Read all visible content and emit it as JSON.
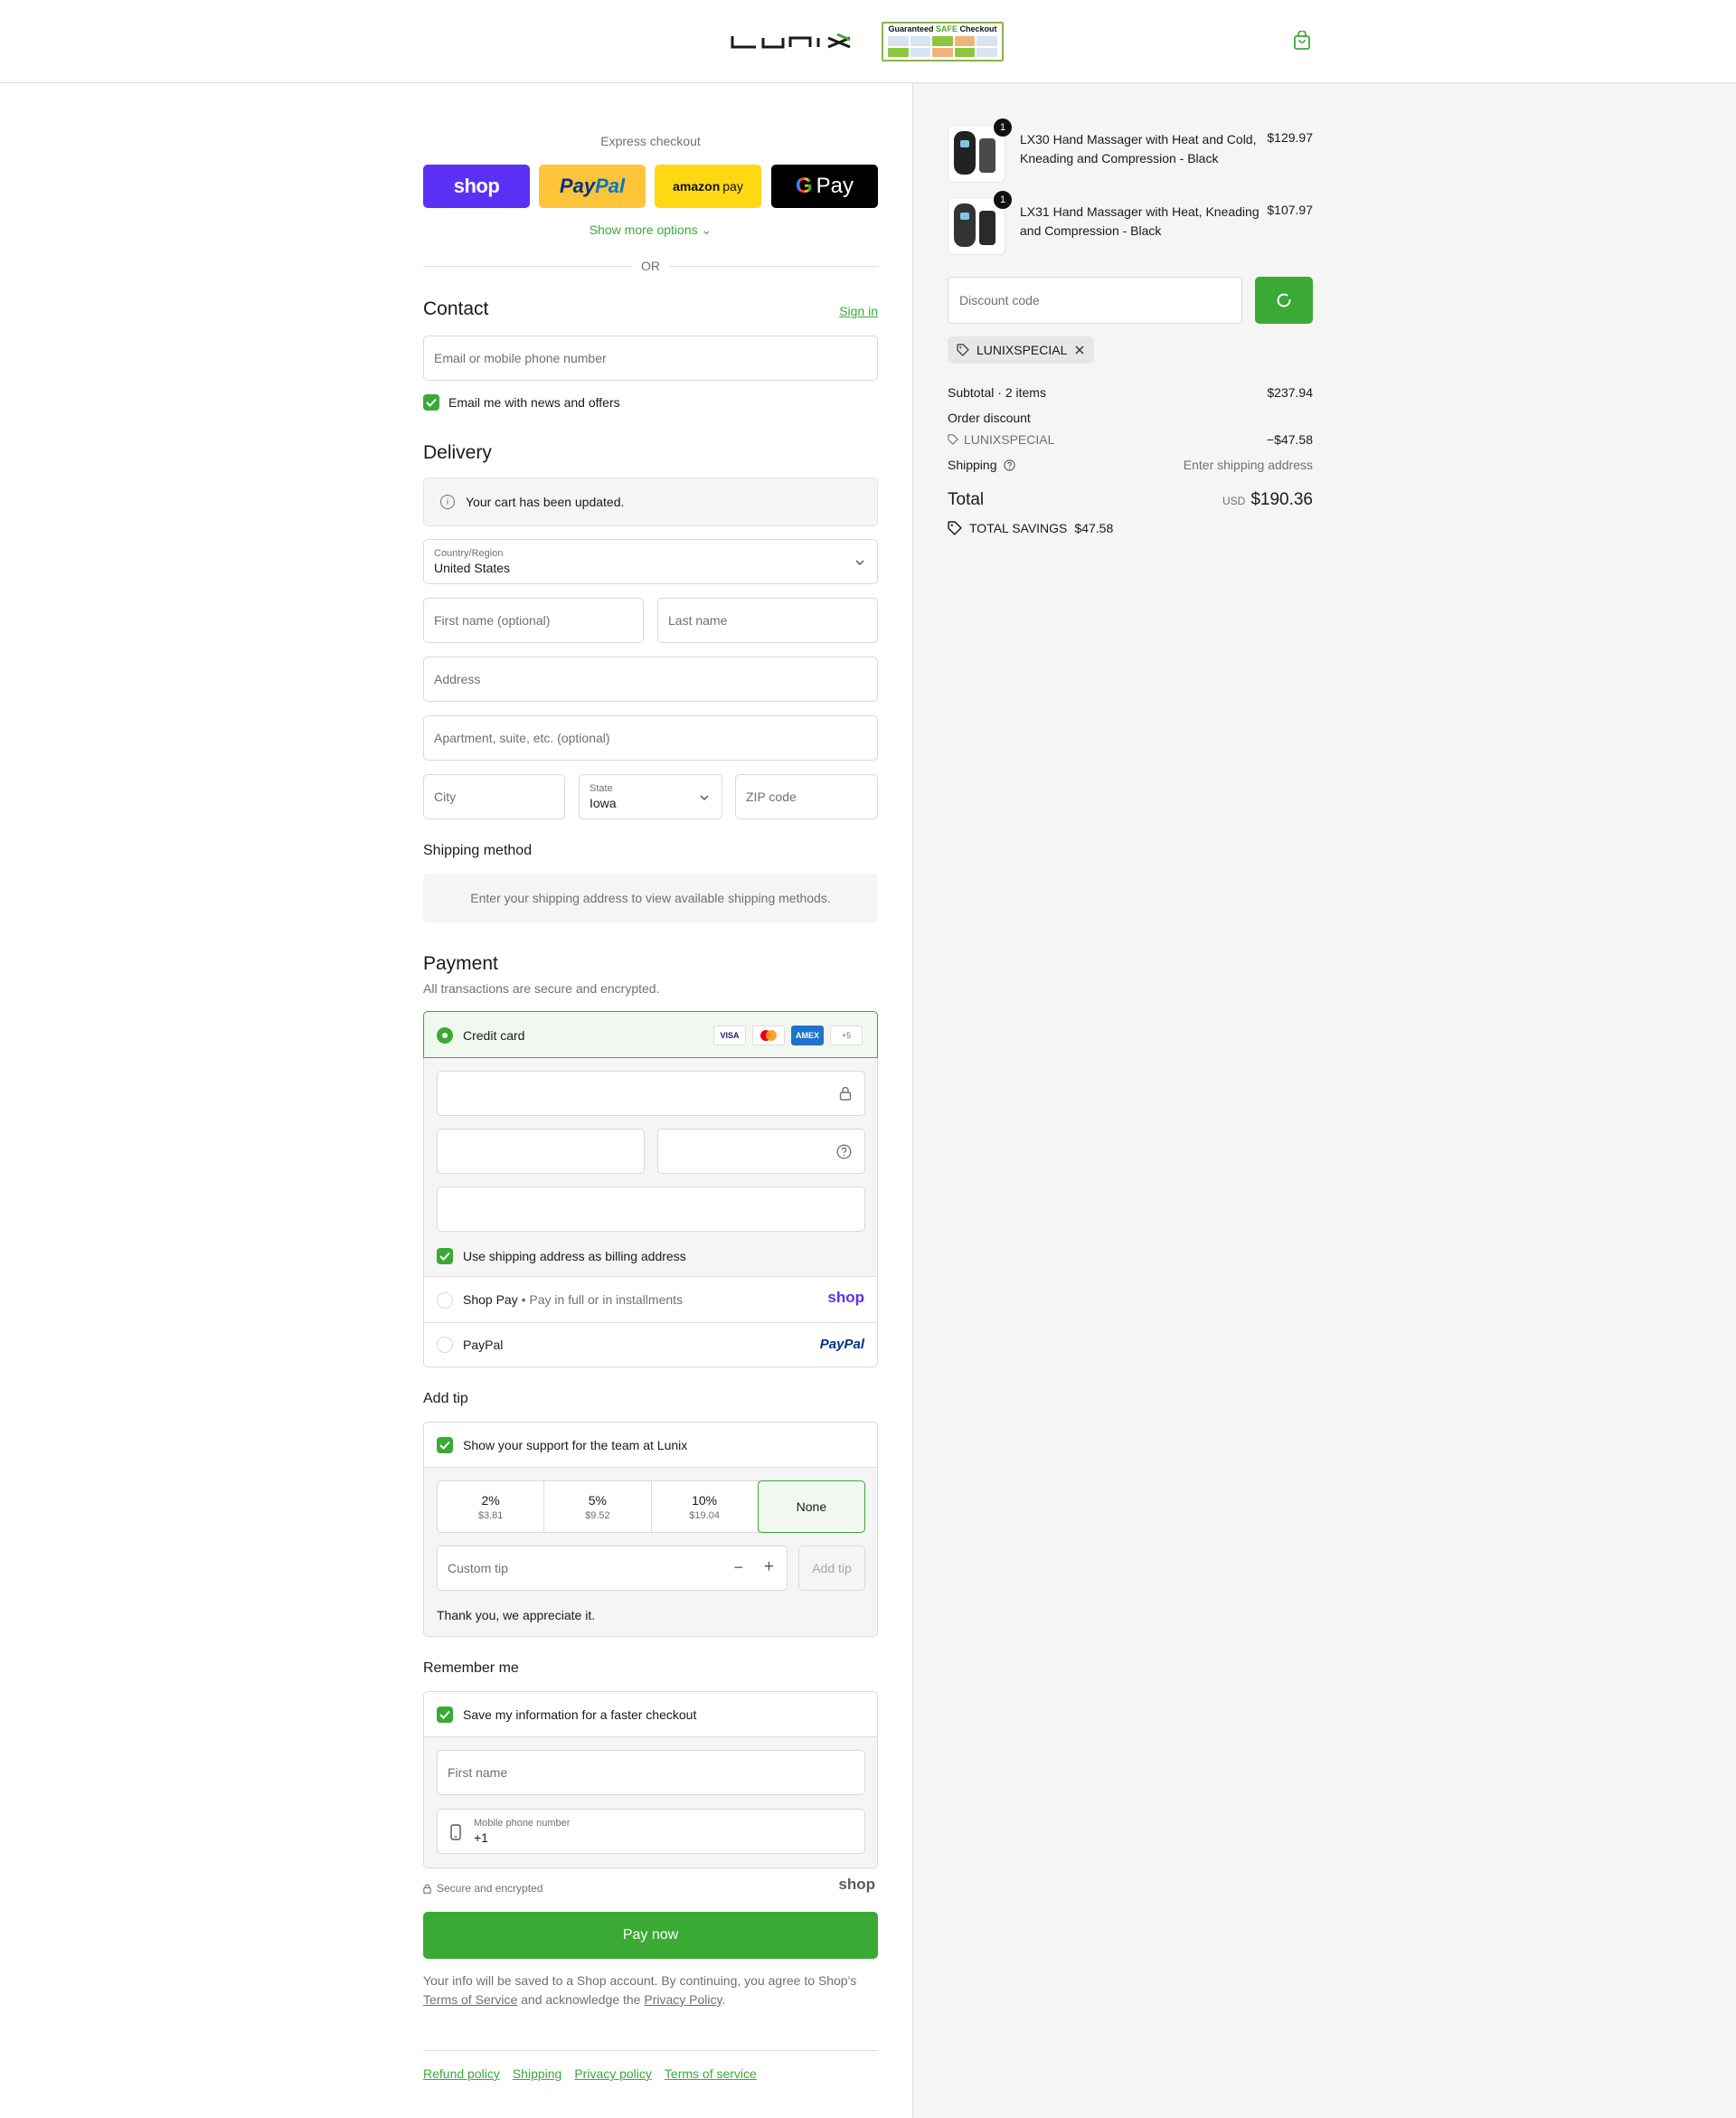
{
  "header": {
    "brand": "Lunix",
    "badge_title_prefix": "Guaranteed",
    "badge_title_safe": "SAFE",
    "badge_title_suffix": "Checkout"
  },
  "express": {
    "title": "Express checkout",
    "shop_label": "shop",
    "paypal_label_1": "Pay",
    "paypal_label_2": "Pal",
    "amazon_label": "amazon",
    "amazon_pay": "pay",
    "gpay_g": "G",
    "gpay_label": "Pay",
    "more_options": "Show more options",
    "or": "OR"
  },
  "contact": {
    "title": "Contact",
    "sign_in": "Sign in",
    "email_placeholder": "Email or mobile phone number",
    "news_label": "Email me with news and offers"
  },
  "delivery": {
    "title": "Delivery",
    "notice": "Your cart has been updated.",
    "country_label": "Country/Region",
    "country_value": "United States",
    "first_name": "First name (optional)",
    "last_name": "Last name",
    "address": "Address",
    "apartment": "Apartment, suite, etc. (optional)",
    "city": "City",
    "state_label": "State",
    "state_value": "Iowa",
    "zip": "ZIP code"
  },
  "shipping_method": {
    "title": "Shipping method",
    "placeholder": "Enter your shipping address to view available shipping methods."
  },
  "payment": {
    "title": "Payment",
    "subtitle": "All transactions are secure and encrypted.",
    "credit_card": "Credit card",
    "visa": "VISA",
    "amex": "AMEX",
    "more_cards": "+5",
    "billing_label": "Use shipping address as billing address",
    "shop_pay": "Shop Pay",
    "shop_pay_desc": "Pay in full or in installments",
    "shop_logo": "shop",
    "paypal": "PayPal",
    "paypal_logo": "PayPal"
  },
  "tip": {
    "title": "Add tip",
    "support_label": "Show your support for the team at Lunix",
    "options": [
      {
        "pct": "2%",
        "amount": "$3.81"
      },
      {
        "pct": "5%",
        "amount": "$9.52"
      },
      {
        "pct": "10%",
        "amount": "$19.04"
      },
      {
        "pct": "None",
        "amount": ""
      }
    ],
    "custom_placeholder": "Custom tip",
    "minus": "−",
    "plus": "+",
    "add_button": "Add tip",
    "thanks": "Thank you, we appreciate it."
  },
  "remember": {
    "title": "Remember me",
    "save_label": "Save my information for a faster checkout",
    "first_name": "First name",
    "phone_label": "Mobile phone number",
    "phone_value": "+1",
    "secure": "Secure and encrypted",
    "shop_logo": "shop"
  },
  "pay_now": "Pay now",
  "legal": {
    "text_1": "Your info will be saved to a Shop account. By continuing, you agree to Shop's",
    "terms": "Terms of Service",
    "text_2": "and acknowledge the",
    "privacy": "Privacy Policy",
    "end": "."
  },
  "footer": {
    "links": [
      "Refund policy",
      "Shipping",
      "Privacy policy",
      "Terms of service"
    ]
  },
  "cart": {
    "items": [
      {
        "name": "LX30 Hand Massager with Heat and Cold, Kneading and Compression - Black",
        "price": "$129.97",
        "qty": "1"
      },
      {
        "name": "LX31 Hand Massager with Heat, Kneading and Compression - Black",
        "price": "$107.97",
        "qty": "1"
      }
    ],
    "discount_placeholder": "Discount code",
    "applied_code": "LUNIXSPECIAL",
    "subtotal_label": "Subtotal · 2 items",
    "subtotal_value": "$237.94",
    "order_discount_label": "Order discount",
    "order_discount_code": "LUNIXSPECIAL",
    "order_discount_value": "−$47.58",
    "shipping_label": "Shipping",
    "shipping_value": "Enter shipping address",
    "total_label": "Total",
    "currency": "USD",
    "total_value": "$190.36",
    "savings_label": "TOTAL SAVINGS",
    "savings_value": "$47.58"
  },
  "colors": {
    "accent": "#3aaa35",
    "shop_purple": "#5a31f4",
    "paypal_yellow": "#ffc439",
    "amazon_yellow": "#ffd814"
  }
}
